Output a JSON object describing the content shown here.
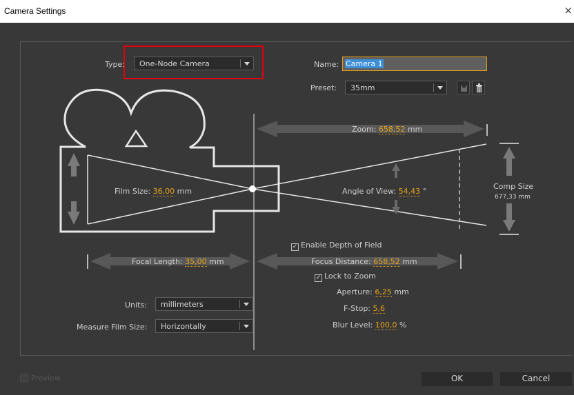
{
  "window": {
    "title": "Camera Settings",
    "close_glyph": "×"
  },
  "type": {
    "label": "Type:",
    "value": "One-Node Camera"
  },
  "name": {
    "label": "Name:",
    "value": "Camera 1"
  },
  "preset": {
    "label": "Preset:",
    "value": "35mm",
    "save_icon": "save-preset-icon",
    "delete_icon": "trash-icon"
  },
  "zoom": {
    "label": "Zoom:",
    "value": "658,52",
    "unit": "mm"
  },
  "film_size": {
    "label": "Film Size:",
    "value": "36,00",
    "unit": "mm"
  },
  "angle_of_view": {
    "label": "Angle of View:",
    "value": "54,43",
    "unit": "°"
  },
  "comp_size": {
    "label": "Comp Size",
    "value": "677,33 mm"
  },
  "depth_of_field": {
    "label": "Enable Depth of Field",
    "checked": true
  },
  "focal_length": {
    "label": "Focal Length:",
    "value": "35,00",
    "unit": "mm"
  },
  "focus_distance": {
    "label": "Focus Distance:",
    "value": "658,52",
    "unit": "mm"
  },
  "lock_to_zoom": {
    "label": "Lock to Zoom",
    "checked": true
  },
  "aperture": {
    "label": "Aperture:",
    "value": "6,25",
    "unit": "mm"
  },
  "fstop": {
    "label": "F-Stop:",
    "value": "5,6"
  },
  "blur_level": {
    "label": "Blur Level:",
    "value": "100,0",
    "unit": "%"
  },
  "units": {
    "label": "Units:",
    "value": "millimeters"
  },
  "measure_film": {
    "label": "Measure Film Size:",
    "value": "Horizontally"
  },
  "footer": {
    "preview_label": "Preview",
    "ok_label": "OK",
    "cancel_label": "Cancel"
  },
  "colors": {
    "accent": "#e8a317",
    "highlight_box": "#e2000f",
    "selection": "#3d8fd6",
    "background": "#383838"
  }
}
